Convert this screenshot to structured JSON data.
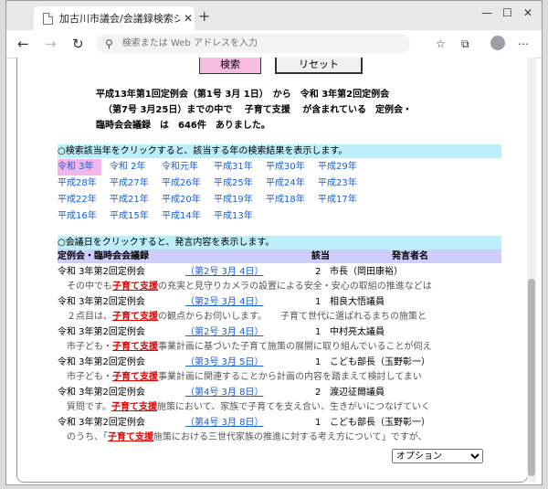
{
  "browser": {
    "tab_title": "加古川市議会/会議録検索システム",
    "tab_close": "✕",
    "new_tab": "+",
    "address_placeholder": "検索または Web アドレスを入力"
  },
  "buttons": {
    "search": "検索",
    "reset": "リセット"
  },
  "summary": {
    "line1": "平成13年第1回定例会（第1号 3月 1日）　から　令和 3年第2回定例会",
    "line2": "（第7号 3月25日）までの中で　 子育て支援　 が含まれている　定例会・",
    "line3": "臨時会会議録　は　646件　ありました。"
  },
  "year_section": {
    "instruction": "○検索該当年をクリックすると、該当する年の検索結果を表示します。",
    "selected": "令和 3年",
    "rows": [
      [
        "令和 3年",
        "令和 2年",
        "令和元年",
        "平成31年",
        "平成30年",
        "平成29年"
      ],
      [
        "平成28年",
        "平成27年",
        "平成26年",
        "平成25年",
        "平成24年",
        "平成23年"
      ],
      [
        "平成22年",
        "平成21年",
        "平成20年",
        "平成19年",
        "平成18年",
        "平成17年"
      ],
      [
        "平成16年",
        "平成15年",
        "平成14年",
        "平成13年"
      ]
    ]
  },
  "meeting_section": {
    "instruction": "○会議日をクリックすると、発言内容を表示します。",
    "col_meeting": "定例会・臨時会会議録",
    "col_hits": "該当",
    "col_speaker": "発言者名",
    "keyword": "子育て支援",
    "records": [
      {
        "meeting": "令和 3年第2回定例会",
        "date": "（第2号 3月 4日）",
        "hits": "2",
        "speaker": "市長（岡田康裕）",
        "pre": "その中でも",
        "post": "の充実と見守りカメラの設置による安全・安心の取組の推進などは"
      },
      {
        "meeting": "令和 3年第2回定例会",
        "date": "（第2号 3月 4日）",
        "hits": "1",
        "speaker": "相良大悟議員",
        "pre": "２点目は、",
        "post": "の観点からお伺いします。　　子育て世代に選ばれるまちの施策と"
      },
      {
        "meeting": "令和 3年第2回定例会",
        "date": "（第2号 3月 4日）",
        "hits": "1",
        "speaker": "中村亮太議員",
        "pre": "市子ども・",
        "post": "事業計画に基づいた子育て施策の展開に取り組んでいることが伺え"
      },
      {
        "meeting": "令和 3年第2回定例会",
        "date": "（第3号 3月 5日）",
        "hits": "1",
        "speaker": "こども部長（玉野彰一）",
        "pre": "市子ども・",
        "post": "事業計画に関連することから計画の内容を踏まえて検討してまい"
      },
      {
        "meeting": "令和 3年第2回定例会",
        "date": "（第4号 3月 8日）",
        "hits": "2",
        "speaker": "渡辺征爾議員",
        "pre": "質問です。",
        "post": "施策において、家族で子育てを支え合い、生きがいにつなげていく"
      },
      {
        "meeting": "令和 3年第2回定例会",
        "date": "（第4号 3月 8日）",
        "hits": "1",
        "speaker": "こども部長（玉野彰一）",
        "pre": "のうち、「",
        "post": "施策における三世代家族の推進に対する考え方について」ですが、"
      }
    ]
  },
  "option_select": "オプション"
}
